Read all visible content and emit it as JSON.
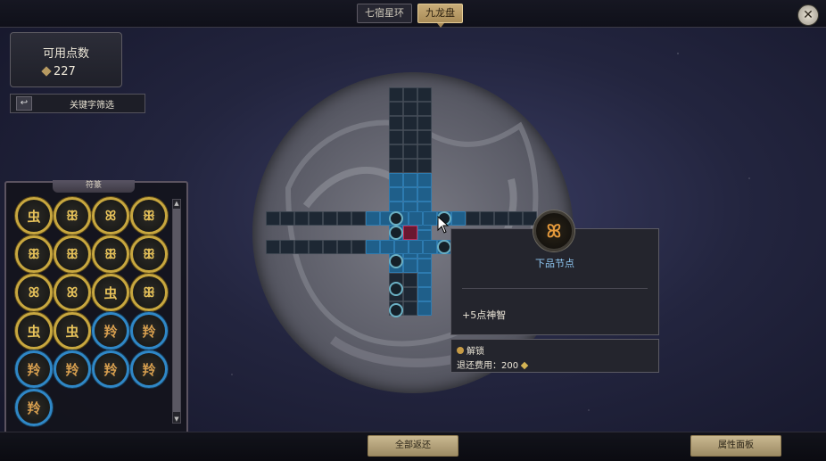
{
  "tabs": [
    {
      "label": "七宿星环",
      "active": false
    },
    {
      "label": "九龙盘",
      "active": true
    }
  ],
  "close_icon": "close-crossed-swords-icon",
  "points": {
    "title": "可用点数",
    "value": "227",
    "icon": "diamond-currency-icon"
  },
  "filter": {
    "label": "关键字筛选",
    "back_icon": "back-arrow-icon"
  },
  "rune_panel": {
    "title": "符篆",
    "runes": [
      {
        "glyph": "虫",
        "ring": "gold"
      },
      {
        "glyph": "ꕥ",
        "ring": "gold"
      },
      {
        "glyph": "ꕤ",
        "ring": "gold"
      },
      {
        "glyph": "ꕥ",
        "ring": "gold"
      },
      {
        "glyph": "ꕥ",
        "ring": "gold"
      },
      {
        "glyph": "ꕥ",
        "ring": "gold"
      },
      {
        "glyph": "ꕥ",
        "ring": "gold"
      },
      {
        "glyph": "ꕥ",
        "ring": "gold"
      },
      {
        "glyph": "ꕤ",
        "ring": "gold"
      },
      {
        "glyph": "ꕤ",
        "ring": "gold"
      },
      {
        "glyph": "虫",
        "ring": "gold"
      },
      {
        "glyph": "ꕥ",
        "ring": "gold"
      },
      {
        "glyph": "虫",
        "ring": "gold"
      },
      {
        "glyph": "虫",
        "ring": "gold"
      },
      {
        "glyph": "羚",
        "ring": "blue"
      },
      {
        "glyph": "羚",
        "ring": "blue"
      },
      {
        "glyph": "羚",
        "ring": "blue"
      },
      {
        "glyph": "羚",
        "ring": "blue"
      },
      {
        "glyph": "羚",
        "ring": "blue"
      },
      {
        "glyph": "羚",
        "ring": "blue"
      },
      {
        "glyph": "羚",
        "ring": "blue"
      }
    ]
  },
  "tooltip": {
    "icon": "dragon-node-icon",
    "title": "下品节点",
    "description": "+5点神智"
  },
  "unlock": {
    "label": "解锁",
    "cost_label": "退还费用：",
    "cost_value": "200"
  },
  "buttons": {
    "refund_all": "全部返还",
    "attributes": "属性面板"
  },
  "colors": {
    "accent_gold": "#c8a73f",
    "accent_blue": "#2f87c6",
    "tooltip_title": "#8fc7f2"
  }
}
